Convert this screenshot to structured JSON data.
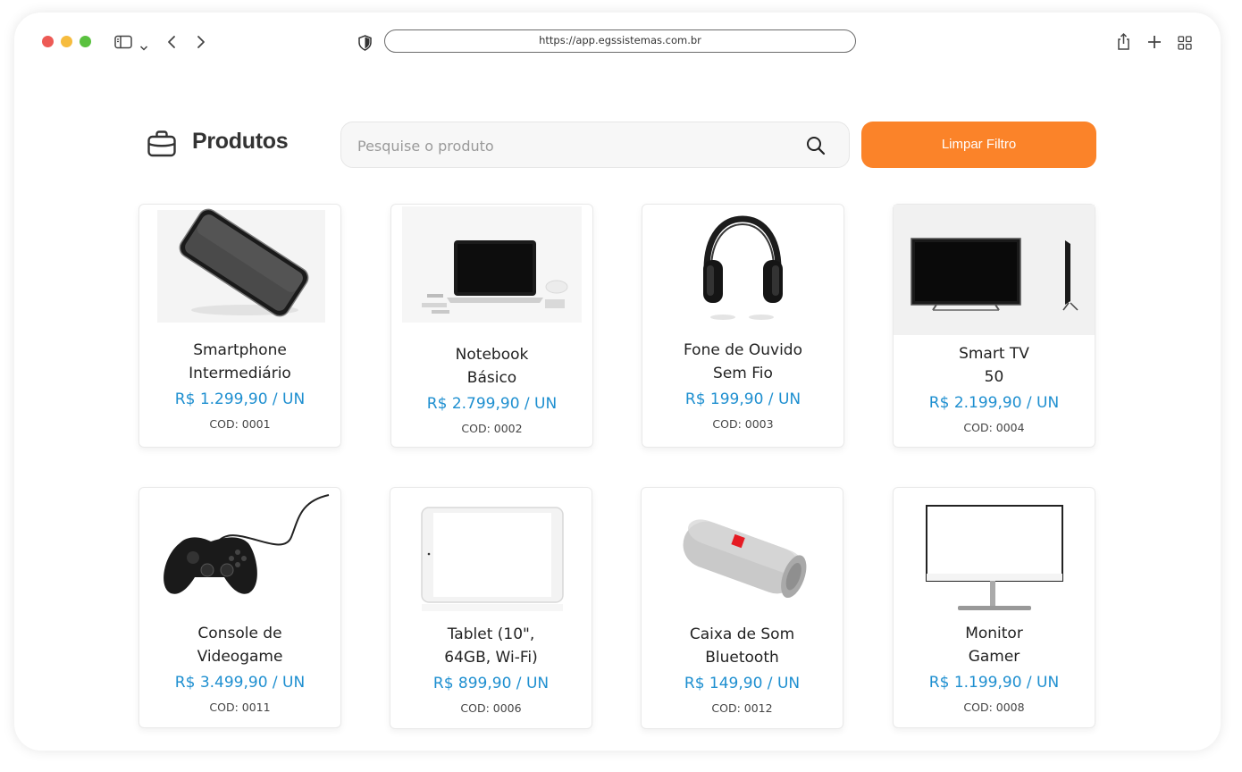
{
  "browser": {
    "url": "https://app.egssistemas.com.br"
  },
  "page": {
    "title": "Produtos",
    "search_placeholder": "Pesquise o produto",
    "search_value": "",
    "clear_button": "Limpar Filtro"
  },
  "products": [
    {
      "line1": "Smartphone",
      "line2": "Intermediário",
      "price": "R$ 1.299,90 / UN",
      "code": "COD: 0001",
      "image": "smartphone"
    },
    {
      "line1": "Notebook",
      "line2": "Básico",
      "price": "R$ 2.799,90 / UN",
      "code": "COD: 0002",
      "image": "notebook"
    },
    {
      "line1": "Fone de Ouvido",
      "line2": "Sem Fio",
      "price": "R$ 199,90 / UN",
      "code": "COD: 0003",
      "image": "headphones"
    },
    {
      "line1": "Smart TV",
      "line2": "50",
      "price": "R$ 2.199,90 / UN",
      "code": "COD: 0004",
      "image": "smart-tv"
    },
    {
      "line1": "Console de",
      "line2": "Videogame",
      "price": "R$ 3.499,90 / UN",
      "code": "COD: 0011",
      "image": "gamepad"
    },
    {
      "line1": "Tablet (10\",",
      "line2": "64GB, Wi-Fi)",
      "price": "R$ 899,90 / UN",
      "code": "COD: 0006",
      "image": "tablet"
    },
    {
      "line1": "Caixa de Som",
      "line2": "Bluetooth",
      "price": "R$ 149,90 / UN",
      "code": "COD: 0012",
      "image": "speaker"
    },
    {
      "line1": "Monitor",
      "line2": "Gamer",
      "price": "R$ 1.199,90 / UN",
      "code": "COD: 0008",
      "image": "monitor"
    }
  ],
  "colors": {
    "accent": "#fb8329",
    "price": "#1e8fd0",
    "traffic_red": "#ed5a55",
    "traffic_yellow": "#f6bc3e",
    "traffic_green": "#5ac13f"
  }
}
